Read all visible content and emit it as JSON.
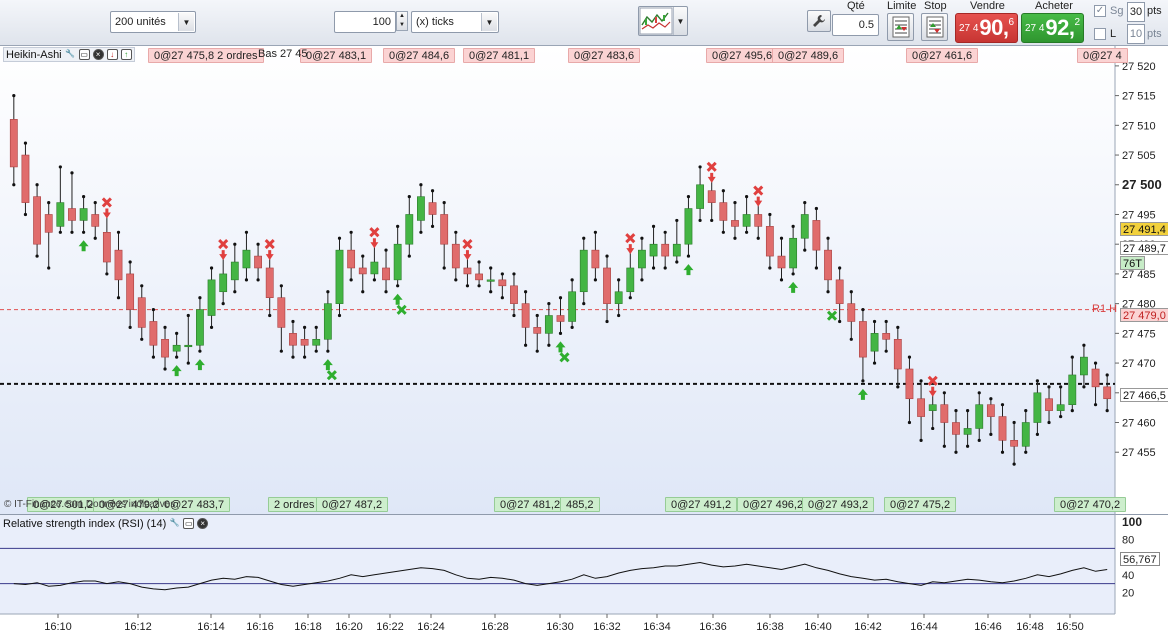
{
  "toolbar": {
    "quantity_combo": "200 unités",
    "ticks_value": "100",
    "ticks_combo": "(x) ticks",
    "qty_label": "Qté",
    "qty_value": "0.5",
    "limit_label": "Limite",
    "stop_label": "Stop",
    "sell_label": "Vendre",
    "buy_label": "Acheter",
    "sell_price": {
      "small": "27 4",
      "big": "90,",
      "sup": "6"
    },
    "buy_price": {
      "small": "27 4",
      "big": "92,",
      "sup": "2"
    },
    "sg_label": "Sg",
    "l_label": "L",
    "pts_value_top": "30",
    "pts_value_bottom": "10",
    "pts_label": "pts",
    "colors": {
      "sell": "#d9403f",
      "buy": "#3aa83a"
    }
  },
  "price_panel": {
    "title": "Heikin-Ashi",
    "axis_labels": [
      "27 520",
      "27 515",
      "27 510",
      "27 505",
      "27 500",
      "27 495",
      "27 490",
      "27 485",
      "27 480",
      "27 475",
      "27 470",
      "27 465",
      "27 460",
      "27 455"
    ],
    "bold_labels": [
      "27 500"
    ],
    "price_markers": [
      {
        "text": "27 491,4",
        "bg": "#f2d13c",
        "fg": "#111"
      },
      {
        "text": "27 489,7",
        "bg": "#ffffff",
        "fg": "#111"
      },
      {
        "text": "76T",
        "bg": "#c7ecc7",
        "fg": "#111"
      },
      {
        "text": "R1 H",
        "bg": "transparent",
        "fg": "#d94040"
      },
      {
        "text": "27 479,0",
        "bg": "#fbd3d3",
        "fg": "#c02020"
      },
      {
        "text": "27 466,5",
        "bg": "#ffffff",
        "fg": "#111"
      }
    ],
    "top_tags": [
      "0@27 475,8 2 ordres",
      "0@27 483,1",
      "0@27 484,6",
      "0@27 481,1",
      "0@27 483,6",
      "0@27 495,6",
      "0@27 489,6",
      "0@27 461,6",
      "0@27 4"
    ],
    "overlay_text": "Bas 27 45",
    "bottom_tags": [
      "0@27 501,2",
      "0@27 479,2",
      "0@27 483,7",
      "2 ordres",
      "0@27 487,2",
      "0@27 481,2",
      "485,2",
      "0@27 491,2",
      "0@27 496,2",
      "0@27 493,2",
      "0@27 475,2",
      "0@27 470,2"
    ],
    "copyright": "© IT-Finance.com Données indicatives"
  },
  "rsi_panel": {
    "title": "Relative strength index (RSI) (14)",
    "axis_labels": [
      "100",
      "80",
      "60",
      "40",
      "20"
    ],
    "value_label": "56,767"
  },
  "time_axis": [
    "16:10",
    "16:12",
    "16:14",
    "16:16",
    "16:18",
    "16:20",
    "16:22",
    "16:24",
    "16:28",
    "16:30",
    "16:32",
    "16:34",
    "16:36",
    "16:38",
    "16:40",
    "16:42",
    "16:44",
    "16:46",
    "16:48",
    "16:50"
  ],
  "chart_data": {
    "type": "candlestick",
    "y_range": [
      27451,
      27522
    ],
    "series": [
      {
        "t": 0,
        "o": 27511,
        "c": 27503,
        "h": 27515,
        "l": 27500
      },
      {
        "t": 1,
        "o": 27505,
        "c": 27497,
        "h": 27507,
        "l": 27495
      },
      {
        "t": 2,
        "o": 27498,
        "c": 27490,
        "h": 27500,
        "l": 27488
      },
      {
        "t": 3,
        "o": 27495,
        "c": 27492,
        "h": 27497,
        "l": 27486
      },
      {
        "t": 4,
        "o": 27493,
        "c": 27497,
        "h": 27503,
        "l": 27492
      },
      {
        "t": 5,
        "o": 27496,
        "c": 27494,
        "h": 27502,
        "l": 27492
      },
      {
        "t": 6,
        "o": 27494,
        "c": 27496,
        "h": 27498,
        "l": 27492
      },
      {
        "t": 7,
        "o": 27495,
        "c": 27493,
        "h": 27497,
        "l": 27491
      },
      {
        "t": 8,
        "o": 27492,
        "c": 27487,
        "h": 27495,
        "l": 27485
      },
      {
        "t": 9,
        "o": 27489,
        "c": 27484,
        "h": 27492,
        "l": 27481
      },
      {
        "t": 10,
        "o": 27485,
        "c": 27479,
        "h": 27487,
        "l": 27476
      },
      {
        "t": 11,
        "o": 27481,
        "c": 27476,
        "h": 27483,
        "l": 27474
      },
      {
        "t": 12,
        "o": 27477,
        "c": 27473,
        "h": 27479,
        "l": 27471
      },
      {
        "t": 13,
        "o": 27474,
        "c": 27471,
        "h": 27476,
        "l": 27469
      },
      {
        "t": 14,
        "o": 27472,
        "c": 27473,
        "h": 27475,
        "l": 27471
      },
      {
        "t": 15,
        "o": 27473,
        "c": 27473,
        "h": 27478,
        "l": 27470
      },
      {
        "t": 16,
        "o": 27473,
        "c": 27479,
        "h": 27481,
        "l": 27472
      },
      {
        "t": 17,
        "o": 27478,
        "c": 27484,
        "h": 27486,
        "l": 27476
      },
      {
        "t": 18,
        "o": 27482,
        "c": 27485,
        "h": 27488,
        "l": 27480
      },
      {
        "t": 19,
        "o": 27484,
        "c": 27487,
        "h": 27490,
        "l": 27482
      },
      {
        "t": 20,
        "o": 27486,
        "c": 27489,
        "h": 27492,
        "l": 27484
      },
      {
        "t": 21,
        "o": 27488,
        "c": 27486,
        "h": 27490,
        "l": 27484
      },
      {
        "t": 22,
        "o": 27486,
        "c": 27481,
        "h": 27488,
        "l": 27478
      },
      {
        "t": 23,
        "o": 27481,
        "c": 27476,
        "h": 27483,
        "l": 27472
      },
      {
        "t": 24,
        "o": 27475,
        "c": 27473,
        "h": 27477,
        "l": 27471
      },
      {
        "t": 25,
        "o": 27474,
        "c": 27473,
        "h": 27476,
        "l": 27471
      },
      {
        "t": 26,
        "o": 27473,
        "c": 27474,
        "h": 27476,
        "l": 27472
      },
      {
        "t": 27,
        "o": 27474,
        "c": 27480,
        "h": 27482,
        "l": 27472
      },
      {
        "t": 28,
        "o": 27480,
        "c": 27489,
        "h": 27491,
        "l": 27478
      },
      {
        "t": 29,
        "o": 27489,
        "c": 27486,
        "h": 27492,
        "l": 27484
      },
      {
        "t": 30,
        "o": 27486,
        "c": 27485,
        "h": 27488,
        "l": 27482
      },
      {
        "t": 31,
        "o": 27485,
        "c": 27487,
        "h": 27490,
        "l": 27484
      },
      {
        "t": 32,
        "o": 27486,
        "c": 27484,
        "h": 27489,
        "l": 27482
      },
      {
        "t": 33,
        "o": 27484,
        "c": 27490,
        "h": 27493,
        "l": 27483
      },
      {
        "t": 34,
        "o": 27490,
        "c": 27495,
        "h": 27498,
        "l": 27488
      },
      {
        "t": 35,
        "o": 27494,
        "c": 27498,
        "h": 27500,
        "l": 27492
      },
      {
        "t": 36,
        "o": 27497,
        "c": 27495,
        "h": 27499,
        "l": 27493
      },
      {
        "t": 37,
        "o": 27495,
        "c": 27490,
        "h": 27497,
        "l": 27486
      },
      {
        "t": 38,
        "o": 27490,
        "c": 27486,
        "h": 27492,
        "l": 27484
      },
      {
        "t": 39,
        "o": 27486,
        "c": 27485,
        "h": 27488,
        "l": 27483
      },
      {
        "t": 40,
        "o": 27485,
        "c": 27484,
        "h": 27487,
        "l": 27483
      },
      {
        "t": 41,
        "o": 27484,
        "c": 27484,
        "h": 27486,
        "l": 27482
      },
      {
        "t": 42,
        "o": 27484,
        "c": 27483,
        "h": 27485,
        "l": 27481
      },
      {
        "t": 43,
        "o": 27483,
        "c": 27480,
        "h": 27485,
        "l": 27478
      },
      {
        "t": 44,
        "o": 27480,
        "c": 27476,
        "h": 27482,
        "l": 27473
      },
      {
        "t": 45,
        "o": 27476,
        "c": 27475,
        "h": 27478,
        "l": 27472
      },
      {
        "t": 46,
        "o": 27475,
        "c": 27478,
        "h": 27480,
        "l": 27473
      },
      {
        "t": 47,
        "o": 27478,
        "c": 27477,
        "h": 27481,
        "l": 27475
      },
      {
        "t": 48,
        "o": 27477,
        "c": 27482,
        "h": 27484,
        "l": 27476
      },
      {
        "t": 49,
        "o": 27482,
        "c": 27489,
        "h": 27491,
        "l": 27480
      },
      {
        "t": 50,
        "o": 27489,
        "c": 27486,
        "h": 27492,
        "l": 27484
      },
      {
        "t": 51,
        "o": 27486,
        "c": 27480,
        "h": 27488,
        "l": 27477
      },
      {
        "t": 52,
        "o": 27480,
        "c": 27482,
        "h": 27484,
        "l": 27478
      },
      {
        "t": 53,
        "o": 27482,
        "c": 27486,
        "h": 27489,
        "l": 27481
      },
      {
        "t": 54,
        "o": 27486,
        "c": 27489,
        "h": 27491,
        "l": 27484
      },
      {
        "t": 55,
        "o": 27488,
        "c": 27490,
        "h": 27493,
        "l": 27486
      },
      {
        "t": 56,
        "o": 27490,
        "c": 27488,
        "h": 27492,
        "l": 27486
      },
      {
        "t": 57,
        "o": 27488,
        "c": 27490,
        "h": 27494,
        "l": 27487
      },
      {
        "t": 58,
        "o": 27490,
        "c": 27496,
        "h": 27498,
        "l": 27488
      },
      {
        "t": 59,
        "o": 27496,
        "c": 27500,
        "h": 27503,
        "l": 27494
      },
      {
        "t": 60,
        "o": 27499,
        "c": 27497,
        "h": 27501,
        "l": 27494
      },
      {
        "t": 61,
        "o": 27497,
        "c": 27494,
        "h": 27499,
        "l": 27492
      },
      {
        "t": 62,
        "o": 27494,
        "c": 27493,
        "h": 27497,
        "l": 27491
      },
      {
        "t": 63,
        "o": 27493,
        "c": 27495,
        "h": 27498,
        "l": 27492
      },
      {
        "t": 64,
        "o": 27495,
        "c": 27493,
        "h": 27497,
        "l": 27491
      },
      {
        "t": 65,
        "o": 27493,
        "c": 27488,
        "h": 27495,
        "l": 27486
      },
      {
        "t": 66,
        "o": 27488,
        "c": 27486,
        "h": 27491,
        "l": 27484
      },
      {
        "t": 67,
        "o": 27486,
        "c": 27491,
        "h": 27493,
        "l": 27485
      },
      {
        "t": 68,
        "o": 27491,
        "c": 27495,
        "h": 27497,
        "l": 27489
      },
      {
        "t": 69,
        "o": 27494,
        "c": 27489,
        "h": 27496,
        "l": 27486
      },
      {
        "t": 70,
        "o": 27489,
        "c": 27484,
        "h": 27491,
        "l": 27482
      },
      {
        "t": 71,
        "o": 27484,
        "c": 27480,
        "h": 27486,
        "l": 27477
      },
      {
        "t": 72,
        "o": 27480,
        "c": 27477,
        "h": 27482,
        "l": 27474
      },
      {
        "t": 73,
        "o": 27477,
        "c": 27471,
        "h": 27479,
        "l": 27467
      },
      {
        "t": 74,
        "o": 27472,
        "c": 27475,
        "h": 27477,
        "l": 27470
      },
      {
        "t": 75,
        "o": 27475,
        "c": 27474,
        "h": 27477,
        "l": 27472
      },
      {
        "t": 76,
        "o": 27474,
        "c": 27469,
        "h": 27476,
        "l": 27466
      },
      {
        "t": 77,
        "o": 27469,
        "c": 27464,
        "h": 27471,
        "l": 27460
      },
      {
        "t": 78,
        "o": 27464,
        "c": 27461,
        "h": 27467,
        "l": 27457
      },
      {
        "t": 79,
        "o": 27462,
        "c": 27463,
        "h": 27465,
        "l": 27459
      },
      {
        "t": 80,
        "o": 27463,
        "c": 27460,
        "h": 27465,
        "l": 27456
      },
      {
        "t": 81,
        "o": 27460,
        "c": 27458,
        "h": 27462,
        "l": 27455
      },
      {
        "t": 82,
        "o": 27458,
        "c": 27459,
        "h": 27462,
        "l": 27456
      },
      {
        "t": 83,
        "o": 27459,
        "c": 27463,
        "h": 27465,
        "l": 27457
      },
      {
        "t": 84,
        "o": 27463,
        "c": 27461,
        "h": 27464,
        "l": 27458
      },
      {
        "t": 85,
        "o": 27461,
        "c": 27457,
        "h": 27463,
        "l": 27455
      },
      {
        "t": 86,
        "o": 27457,
        "c": 27456,
        "h": 27460,
        "l": 27453
      },
      {
        "t": 87,
        "o": 27456,
        "c": 27460,
        "h": 27462,
        "l": 27455
      },
      {
        "t": 88,
        "o": 27460,
        "c": 27465,
        "h": 27467,
        "l": 27458
      },
      {
        "t": 89,
        "o": 27464,
        "c": 27462,
        "h": 27466,
        "l": 27460
      },
      {
        "t": 90,
        "o": 27462,
        "c": 27463,
        "h": 27466,
        "l": 27461
      },
      {
        "t": 91,
        "o": 27463,
        "c": 27468,
        "h": 27471,
        "l": 27462
      },
      {
        "t": 92,
        "o": 27468,
        "c": 27471,
        "h": 27473,
        "l": 27466
      },
      {
        "t": 93,
        "o": 27469,
        "c": 27466,
        "h": 27470,
        "l": 27463
      },
      {
        "t": 94,
        "o": 27466,
        "c": 27464,
        "h": 27468,
        "l": 27462
      }
    ],
    "rsi": [
      30,
      29,
      31,
      27,
      28,
      31,
      33,
      33,
      30,
      32,
      30,
      26,
      24,
      23,
      25,
      26,
      30,
      34,
      36,
      35,
      38,
      37,
      33,
      29,
      27,
      29,
      31,
      33,
      36,
      40,
      38,
      40,
      42,
      44,
      46,
      48,
      47,
      45,
      40,
      36,
      35,
      37,
      36,
      34,
      30,
      28,
      30,
      32,
      35,
      40,
      36,
      38,
      42,
      45,
      47,
      48,
      50,
      50,
      52,
      54,
      51,
      49,
      50,
      52,
      50,
      48,
      46,
      49,
      52,
      48,
      45,
      41,
      38,
      36,
      34,
      35,
      32,
      30,
      28,
      32,
      31,
      33,
      35,
      34,
      32,
      31,
      33,
      36,
      40,
      38,
      41,
      45,
      48,
      44,
      46
    ],
    "levels": {
      "r1": 27479,
      "dashed_black": 27466.5
    }
  }
}
